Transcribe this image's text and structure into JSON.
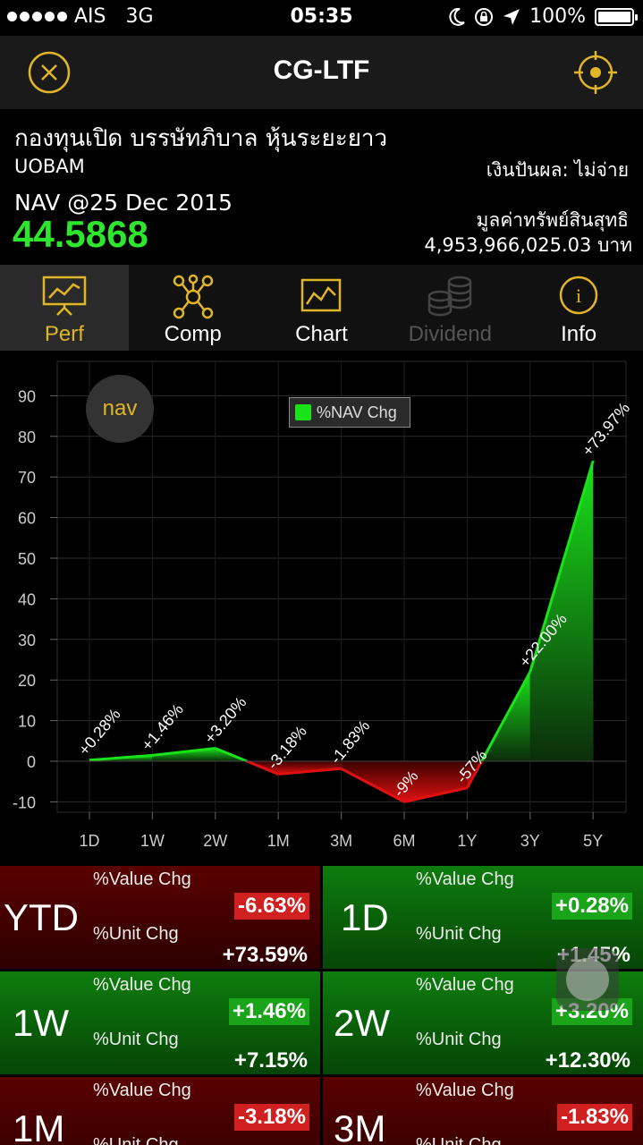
{
  "status_bar": {
    "carrier": "AIS",
    "network": "3G",
    "time": "05:35",
    "battery": "100%"
  },
  "header": {
    "title": "CG-LTF",
    "close_icon": "close-circle-icon",
    "locate_icon": "crosshair-icon"
  },
  "fund": {
    "name": "กองทุนเปิด บรรษัทภิบาล หุ้นระยะยาว",
    "company": "UOBAM",
    "dividend_status": "เงินปันผล: ไม่จ่าย",
    "nav_date": "NAV @25 Dec 2015",
    "nav_value": "44.5868",
    "asset_label": "มูลค่าทรัพย์สินสุทธิ",
    "asset_value": "4,953,966,025.03 บาท"
  },
  "tabs": [
    {
      "label": "Perf",
      "icon": "presentation-chart-icon",
      "active": true
    },
    {
      "label": "Comp",
      "icon": "network-icon",
      "active": false
    },
    {
      "label": "Chart",
      "icon": "line-chart-icon",
      "active": false
    },
    {
      "label": "Dividend",
      "icon": "coins-icon",
      "active": false,
      "disabled": true
    },
    {
      "label": "Info",
      "icon": "info-icon",
      "active": false
    }
  ],
  "chart_toggle": "nav",
  "chart_data": {
    "type": "area",
    "categories": [
      "1D",
      "1W",
      "2W",
      "1M",
      "3M",
      "6M",
      "1Y",
      "3Y",
      "5Y"
    ],
    "series": [
      {
        "name": "%NAV Chg",
        "values": [
          0.28,
          1.46,
          3.2,
          -3.18,
          -1.83,
          -10.0,
          -6.57,
          22.0,
          73.97
        ]
      }
    ],
    "data_labels": [
      "+0.28%",
      "+1.46%",
      "+3.20%",
      "-3.18%",
      "-1.83%",
      "-9%",
      "-57%",
      "+22.00%",
      "+73.97%"
    ],
    "y_ticks": [
      "90",
      "80",
      "70",
      "60",
      "50",
      "40",
      "30",
      "20",
      "10",
      "0",
      "-10"
    ],
    "ylim": [
      -12,
      93
    ],
    "legend_position": "top-center",
    "colors": {
      "positive": "#19e219",
      "negative": "#e01010"
    }
  },
  "performance": [
    {
      "period": "YTD",
      "value_label": "%Value Chg",
      "value_chg": "-6.63%",
      "unit_label": "%Unit Chg",
      "unit_chg": "+73.59%",
      "tone": "red"
    },
    {
      "period": "1D",
      "value_label": "%Value Chg",
      "value_chg": "+0.28%",
      "unit_label": "%Unit Chg",
      "unit_chg": "+1.45%",
      "tone": "green"
    },
    {
      "period": "1W",
      "value_label": "%Value Chg",
      "value_chg": "+1.46%",
      "unit_label": "%Unit Chg",
      "unit_chg": "+7.15%",
      "tone": "green"
    },
    {
      "period": "2W",
      "value_label": "%Value Chg",
      "value_chg": "+3.20%",
      "unit_label": "%Unit Chg",
      "unit_chg": "+12.30%",
      "tone": "green"
    },
    {
      "period": "1M",
      "value_label": "%Value Chg",
      "value_chg": "-3.18%",
      "unit_label": "%Unit Chg",
      "unit_chg": "",
      "tone": "red"
    },
    {
      "period": "3M",
      "value_label": "%Value Chg",
      "value_chg": "-1.83%",
      "unit_label": "%Unit Chg",
      "unit_chg": "",
      "tone": "red"
    }
  ]
}
